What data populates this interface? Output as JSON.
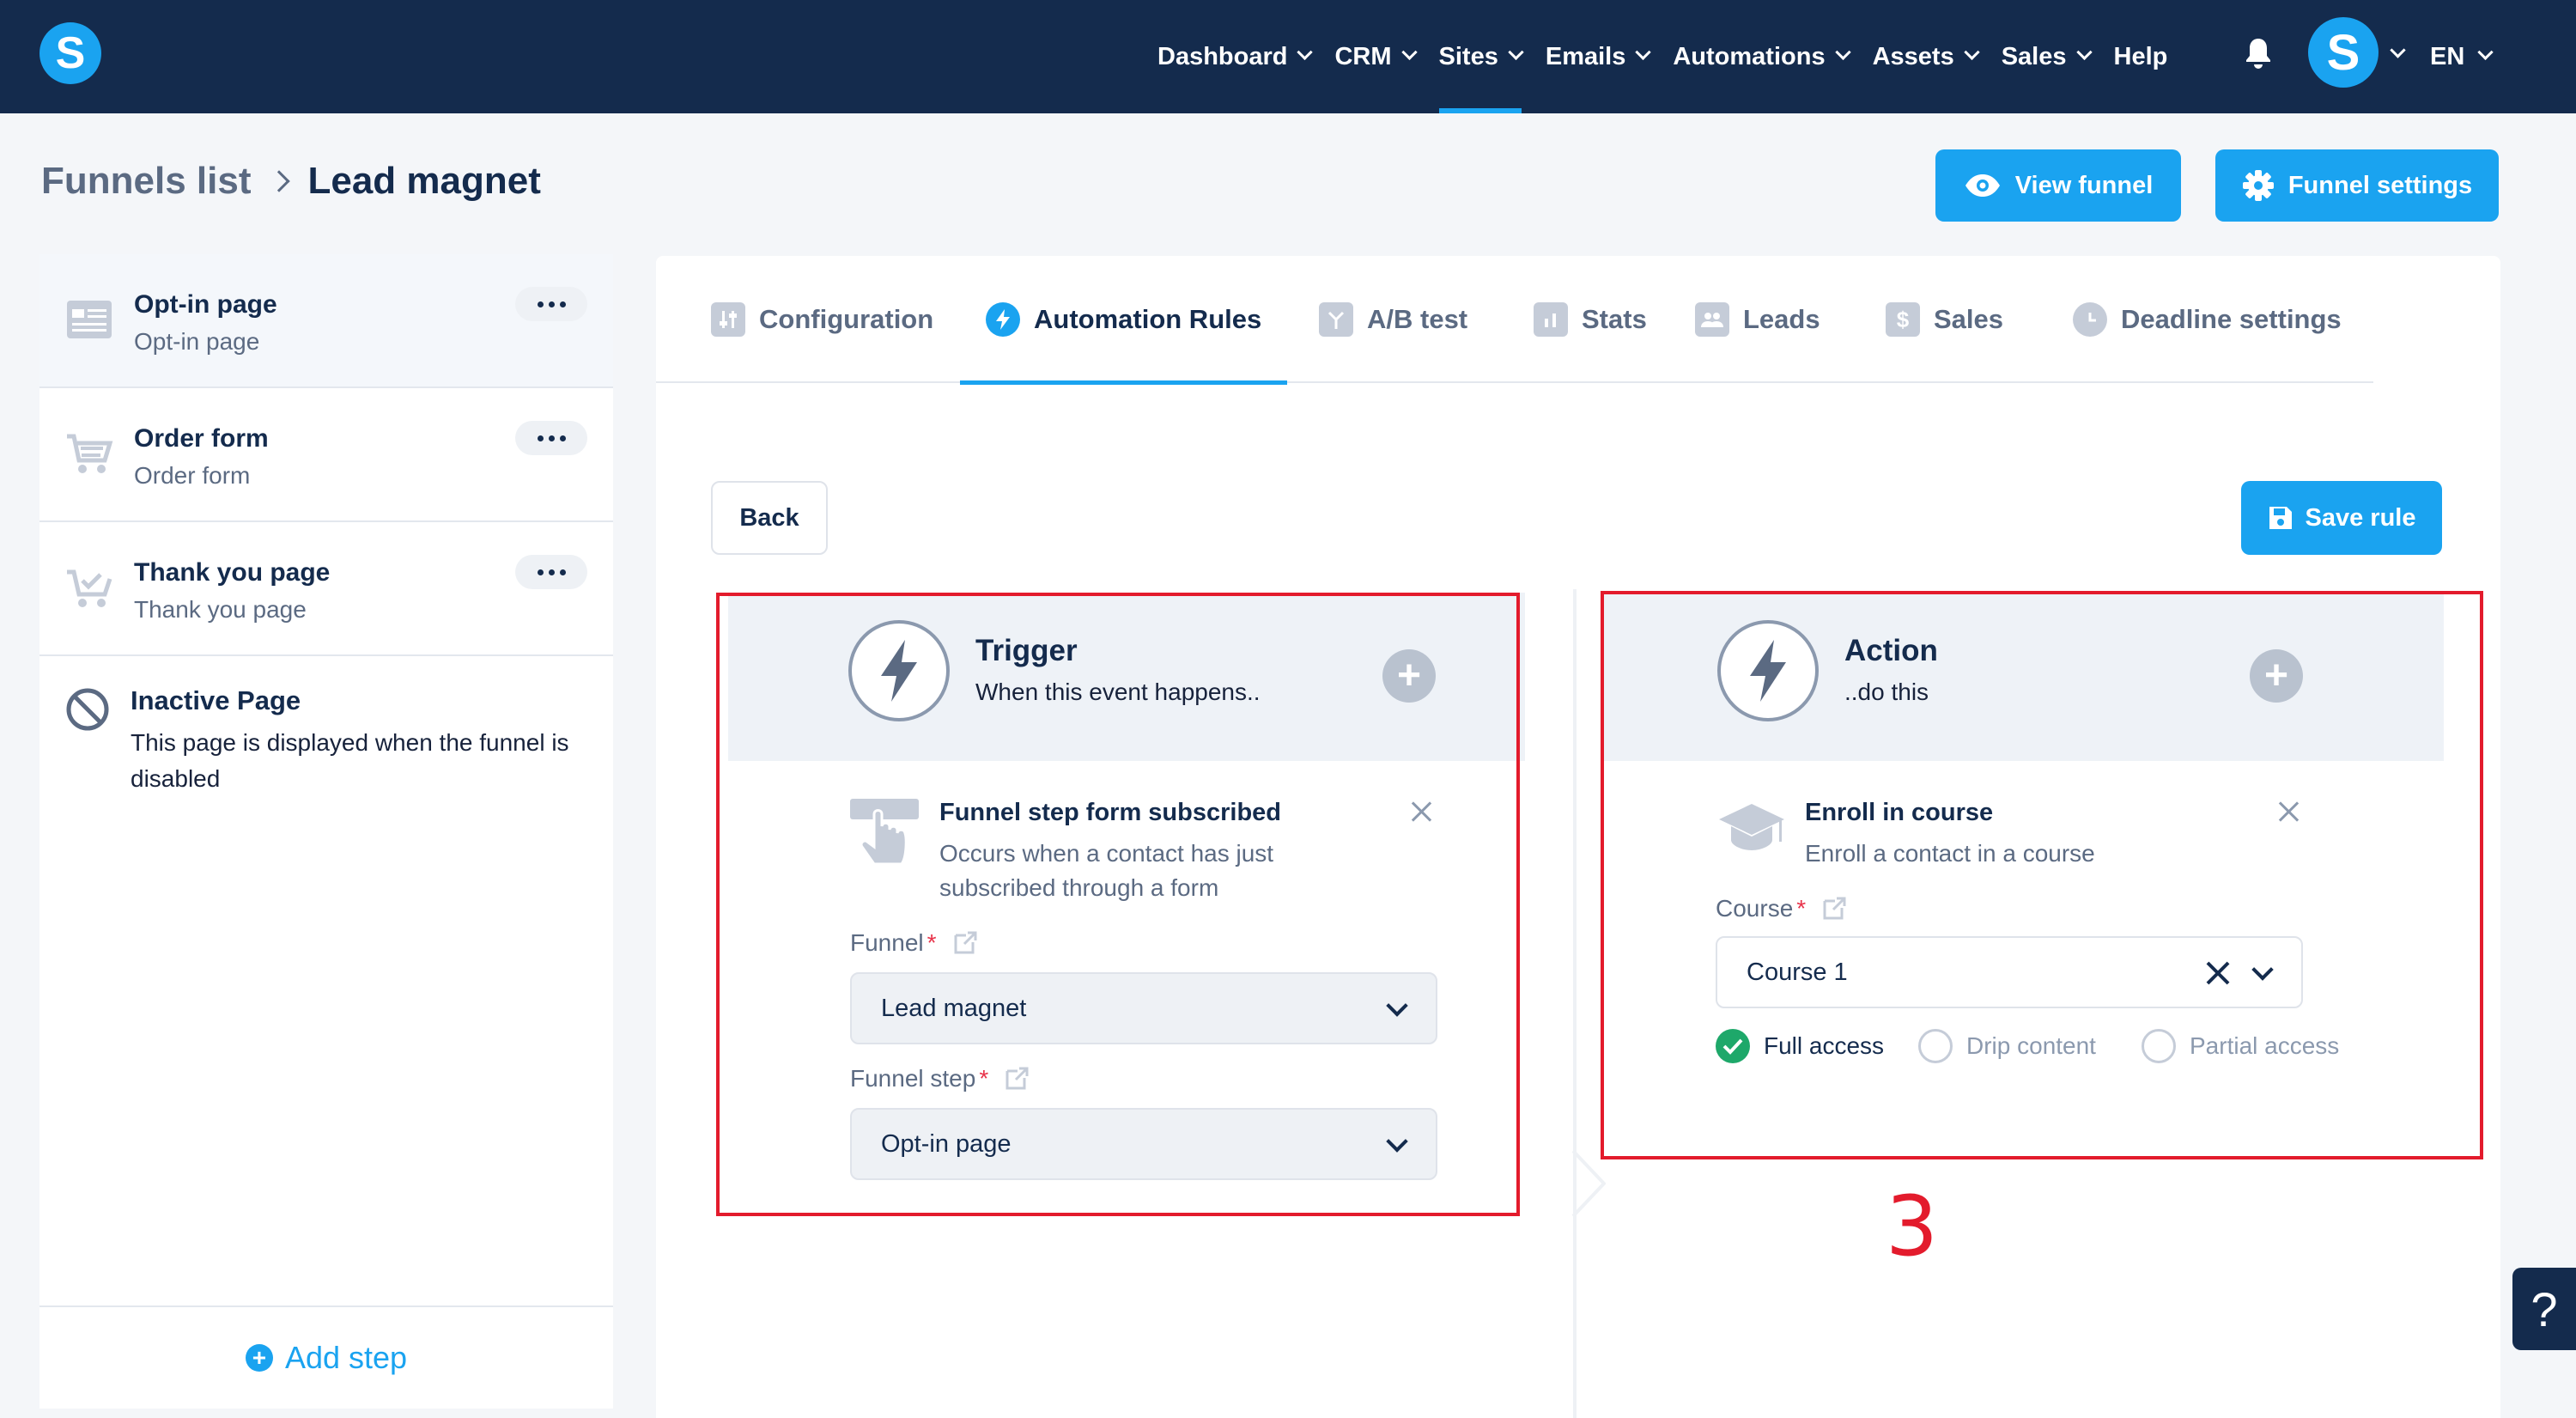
{
  "nav": {
    "logo_letter": "S",
    "items": [
      {
        "label": "Dashboard",
        "has_menu": true
      },
      {
        "label": "CRM",
        "has_menu": true
      },
      {
        "label": "Sites",
        "has_menu": true,
        "active": true
      },
      {
        "label": "Emails",
        "has_menu": true
      },
      {
        "label": "Automations",
        "has_menu": true
      },
      {
        "label": "Assets",
        "has_menu": true
      },
      {
        "label": "Sales",
        "has_menu": true
      },
      {
        "label": "Help",
        "has_menu": false
      }
    ],
    "avatar_letter": "S",
    "language": "EN"
  },
  "breadcrumb": {
    "parent": "Funnels list",
    "current": "Lead magnet"
  },
  "header_buttons": {
    "view_funnel": "View funnel",
    "funnel_settings": "Funnel settings"
  },
  "sidebar": {
    "steps": [
      {
        "title": "Opt-in page",
        "subtitle": "Opt-in page",
        "icon": "page-layout-icon"
      },
      {
        "title": "Order form",
        "subtitle": "Order form",
        "icon": "cart-icon"
      },
      {
        "title": "Thank you page",
        "subtitle": "Thank you page",
        "icon": "cart-check-icon"
      }
    ],
    "inactive": {
      "title": "Inactive Page",
      "description": "This page is displayed when the funnel is disabled"
    },
    "add_step": "Add step"
  },
  "tabs": [
    {
      "label": "Configuration",
      "icon": "sliders-icon"
    },
    {
      "label": "Automation Rules",
      "icon": "bolt-icon",
      "active": true
    },
    {
      "label": "A/B test",
      "icon": "split-icon"
    },
    {
      "label": "Stats",
      "icon": "bar-chart-icon"
    },
    {
      "label": "Leads",
      "icon": "users-icon"
    },
    {
      "label": "Sales",
      "icon": "dollar-icon"
    },
    {
      "label": "Deadline settings",
      "icon": "clock-icon"
    }
  ],
  "buttons": {
    "back": "Back",
    "save_rule": "Save rule"
  },
  "trigger": {
    "title": "Trigger",
    "subtitle": "When this event happens..",
    "event_title": "Funnel step form subscribed",
    "event_desc_line1": "Occurs when a contact has just",
    "event_desc_line2": "subscribed through a form",
    "funnel_label": "Funnel",
    "funnel_value": "Lead magnet",
    "step_label": "Funnel step",
    "step_value": "Opt-in page"
  },
  "action": {
    "title": "Action",
    "subtitle": "..do this",
    "item_title": "Enroll in course",
    "item_desc": "Enroll a contact in a course",
    "course_label": "Course",
    "course_value": "Course 1",
    "access_options": [
      {
        "label": "Full access",
        "checked": true
      },
      {
        "label": "Drip content",
        "checked": false
      },
      {
        "label": "Partial access",
        "checked": false
      }
    ]
  },
  "annotation": "3",
  "help_label": "?",
  "colors": {
    "navy": "#142b4d",
    "accent": "#1aa3f0",
    "annotation_red": "#e31b2c",
    "success_green": "#1ea86a"
  }
}
